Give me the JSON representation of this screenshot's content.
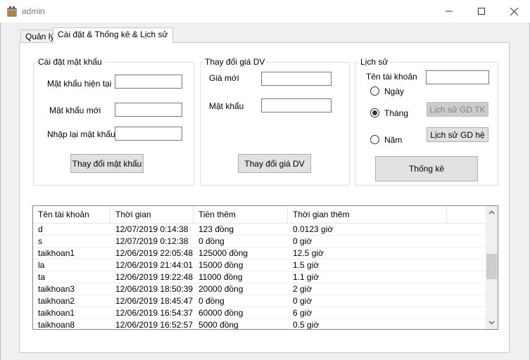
{
  "window": {
    "title": "admin"
  },
  "tabs": [
    {
      "label": "Quản lý",
      "active": false
    },
    {
      "label": "Cài đặt & Thống kê & Lịch sử",
      "active": true
    }
  ],
  "password_group": {
    "legend": "Cài đặt mật khẩu",
    "current_label": "Mật khẩu hiện tại",
    "new_label": "Mật khẩu mới",
    "confirm_label": "Nhập lại mật khẩu",
    "current_value": "",
    "new_value": "",
    "confirm_value": "",
    "button": "Thay đổi mật khẩu"
  },
  "price_group": {
    "legend": "Thay đổi giá DV",
    "price_label": "Giá mới",
    "password_label": "Mật khẩu",
    "price_value": "",
    "password_value": "",
    "button": "Thay đổi giá DV"
  },
  "history_group": {
    "legend": "Lịch sử",
    "account_label": "Tên tài khoản",
    "account_value": "",
    "radio_day": "Ngày",
    "radio_month": "Tháng",
    "radio_year": "Năm",
    "selected": "month",
    "account_history_button": "Lịch sử GD TK",
    "system_history_button": "Lịch sử GD hệ",
    "stats_button": "Thống kê"
  },
  "table": {
    "columns": [
      "Tên tài khoản",
      "Thời gian",
      "Tiền thêm",
      "Thời gian thêm"
    ],
    "rows": [
      [
        "d",
        "12/07/2019 0:14:38",
        "123 đồng",
        "0.0123 giờ"
      ],
      [
        "s",
        "12/07/2019 0:12:38",
        "0 đồng",
        "0 giờ"
      ],
      [
        "taikhoan1",
        "12/06/2019 22:05:48",
        "125000 đồng",
        "12.5 giờ"
      ],
      [
        "la",
        "12/06/2019 21:44:01",
        "15000 đồng",
        "1.5 giờ"
      ],
      [
        "ta",
        "12/06/2019 19:22:48",
        "11000 đồng",
        "1.1 giờ"
      ],
      [
        "taikhoan3",
        "12/06/2019 18:50:39",
        "20000 đồng",
        "2 giờ"
      ],
      [
        "taikhoan2",
        "12/06/2019 18:45:47",
        "0 đồng",
        "0 giờ"
      ],
      [
        "taikhoan1",
        "12/06/2019 16:54:37",
        "60000 đồng",
        "6 giờ"
      ],
      [
        "taikhoan8",
        "12/06/2019 16:52:57",
        "5000 đồng",
        "0.5 giờ"
      ]
    ]
  }
}
